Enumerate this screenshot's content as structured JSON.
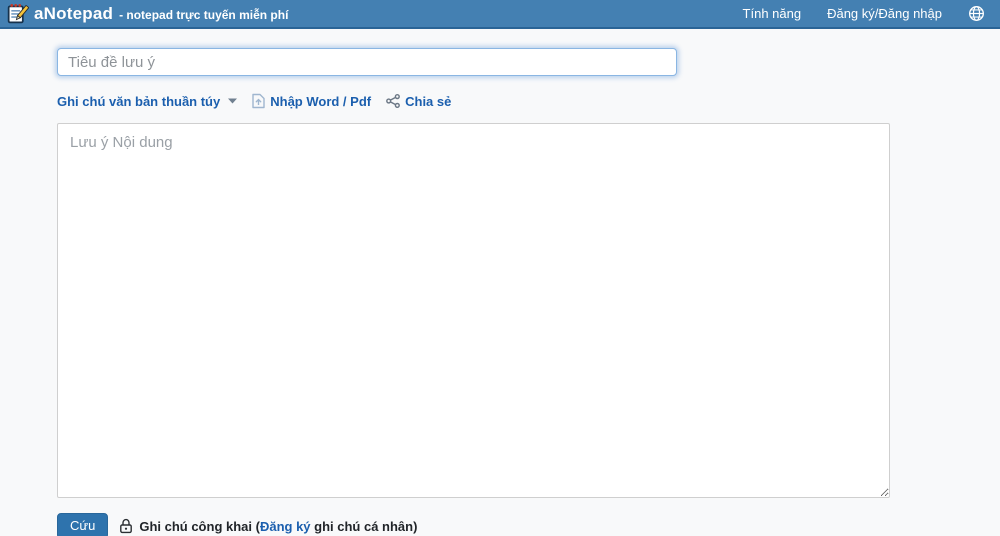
{
  "navbar": {
    "brand": "aNotepad",
    "tagline": "- notepad trực tuyến miễn phí",
    "links": [
      {
        "label": "Tính năng"
      },
      {
        "label": "Đăng ký/Đăng nhập"
      }
    ],
    "globe_icon": "language-globe"
  },
  "editor": {
    "title_placeholder": "Tiêu đề lưu ý",
    "content_placeholder": "Lưu ý Nội dung",
    "toolbar": {
      "note_type_label": "Ghi chú văn bản thuần túy",
      "note_type_icon": "caret-down",
      "import_label": "Nhập Word / Pdf",
      "import_icon": "file-upload",
      "share_label": "Chia sẻ",
      "share_icon": "share-nodes"
    },
    "footer": {
      "save_label": "Cứu",
      "lock_icon": "padlock",
      "visibility_prefix": "Ghi chú công khai (",
      "register_link": "Đăng ký",
      "visibility_suffix": " ghi chú cá nhân)"
    }
  },
  "colors": {
    "navbar_bg": "#4480b2",
    "navbar_border": "#2a6496",
    "link_blue": "#1b5fae",
    "save_button_bg": "#2e73ad",
    "title_input_focus_border": "#8ab6e3",
    "page_bg": "#f8f9fa"
  }
}
